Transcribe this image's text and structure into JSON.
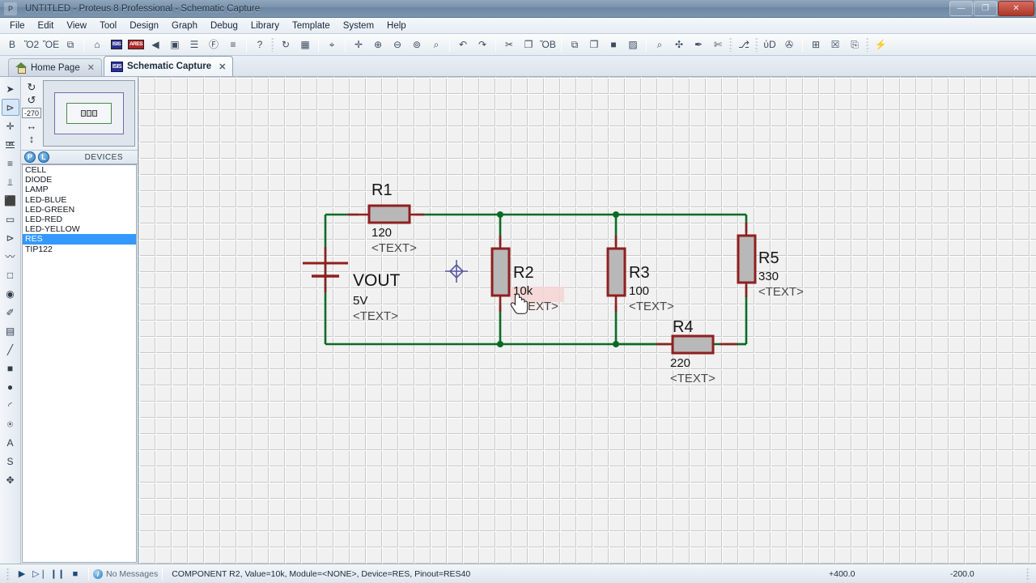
{
  "window": {
    "title": "UNTITLED - Proteus 8 Professional - Schematic Capture",
    "app_icon": "proteus-icon",
    "minimize": "—",
    "maximize": "❐",
    "close": "✕"
  },
  "menu": {
    "items": [
      "File",
      "Edit",
      "View",
      "Tool",
      "Design",
      "Graph",
      "Debug",
      "Library",
      "Template",
      "System",
      "Help"
    ]
  },
  "toolbar": {
    "groups": [
      {
        "buttons": [
          {
            "name": "new-file-icon",
            "glyph": "὜B"
          },
          {
            "name": "open-file-icon",
            "glyph": "Ὄ2"
          },
          {
            "name": "save-icon",
            "glyph": "ὋE"
          },
          {
            "name": "save-all-icon",
            "glyph": "⧉"
          }
        ]
      },
      {
        "buttons": [
          {
            "name": "home-page-icon",
            "glyph": "⌂"
          },
          {
            "name": "isis-schematic-icon",
            "glyph": "ISIS"
          },
          {
            "name": "ares-pcb-icon",
            "glyph": "ARES"
          },
          {
            "name": "back-icon",
            "glyph": "◀"
          },
          {
            "name": "3d-viewer-icon",
            "glyph": "▣"
          },
          {
            "name": "bill-of-materials-icon",
            "glyph": "☰"
          },
          {
            "name": "report-icon",
            "glyph": "Ⓕ"
          },
          {
            "name": "design-explorer-icon",
            "glyph": "≡"
          }
        ]
      },
      {
        "buttons": [
          {
            "name": "help-icon",
            "glyph": "?"
          }
        ]
      },
      {
        "buttons": [
          {
            "name": "refresh-display-icon",
            "glyph": "↻"
          },
          {
            "name": "toggle-grid-icon",
            "glyph": "▦"
          }
        ]
      },
      {
        "buttons": [
          {
            "name": "origin-icon",
            "glyph": "⌖"
          }
        ]
      },
      {
        "buttons": [
          {
            "name": "pan-icon",
            "glyph": "✛"
          },
          {
            "name": "zoom-in-icon",
            "glyph": "⊕"
          },
          {
            "name": "zoom-out-icon",
            "glyph": "⊖"
          },
          {
            "name": "zoom-all-icon",
            "glyph": "⊚"
          },
          {
            "name": "zoom-area-icon",
            "glyph": "⌕"
          }
        ]
      },
      {
        "buttons": [
          {
            "name": "undo-icon",
            "glyph": "↶"
          },
          {
            "name": "redo-icon",
            "glyph": "↷"
          }
        ]
      },
      {
        "buttons": [
          {
            "name": "cut-icon",
            "glyph": "✂"
          },
          {
            "name": "copy-icon",
            "glyph": "❐"
          },
          {
            "name": "paste-icon",
            "glyph": "ὌB"
          }
        ]
      },
      {
        "buttons": [
          {
            "name": "block-copy-icon",
            "glyph": "⧉"
          },
          {
            "name": "block-move-icon",
            "glyph": "❐"
          },
          {
            "name": "block-rotate-icon",
            "glyph": "■"
          },
          {
            "name": "block-delete-icon",
            "glyph": "▨"
          }
        ]
      },
      {
        "buttons": [
          {
            "name": "pick-device-icon",
            "glyph": "⌕"
          },
          {
            "name": "make-device-icon",
            "glyph": "✣"
          },
          {
            "name": "packaging-tool-icon",
            "glyph": "✒"
          },
          {
            "name": "decompose-icon",
            "glyph": "✄"
          }
        ]
      },
      {
        "buttons": [
          {
            "name": "wire-autorouter-icon",
            "glyph": "⎇"
          }
        ]
      },
      {
        "buttons": [
          {
            "name": "search-tag-icon",
            "glyph": "ὐD"
          },
          {
            "name": "property-assignment-icon",
            "glyph": "✇"
          }
        ]
      },
      {
        "buttons": [
          {
            "name": "new-sheet-icon",
            "glyph": "⊞"
          },
          {
            "name": "remove-sheet-icon",
            "glyph": "☒"
          },
          {
            "name": "exit-sheet-icon",
            "glyph": "⎘"
          }
        ]
      },
      {
        "buttons": [
          {
            "name": "simulation-icon",
            "glyph": "⚡"
          }
        ]
      }
    ]
  },
  "tabs": [
    {
      "label": "Home Page",
      "icon": "home-icon",
      "close": "✕",
      "active": false
    },
    {
      "label": "Schematic Capture",
      "icon": "isis-icon",
      "close": "✕",
      "active": true
    }
  ],
  "toolstrip": {
    "items": [
      {
        "name": "selection-mode-tool",
        "glyph": "➤",
        "selected": false
      },
      {
        "name": "component-mode-tool",
        "glyph": "⊳",
        "selected": true
      },
      {
        "name": "junction-dot-tool",
        "glyph": "✛",
        "selected": false
      },
      {
        "name": "wire-label-tool",
        "glyph": "LBL",
        "selected": false
      },
      {
        "name": "text-script-tool",
        "glyph": "≡",
        "selected": false
      },
      {
        "name": "buses-tool",
        "glyph": "⫫",
        "selected": false
      },
      {
        "name": "subcircuit-tool",
        "glyph": "⬛",
        "selected": false
      },
      {
        "name": "terminals-mode-tool",
        "glyph": "▭",
        "selected": false
      },
      {
        "name": "device-pin-tool",
        "glyph": "⊳",
        "selected": false
      },
      {
        "name": "graph-mode-tool",
        "glyph": "〰",
        "selected": false
      },
      {
        "name": "tape-recorder-tool",
        "glyph": "□",
        "selected": false
      },
      {
        "name": "generator-mode-tool",
        "glyph": "◉",
        "selected": false
      },
      {
        "name": "voltage-probe-tool",
        "glyph": "✐",
        "selected": false
      },
      {
        "name": "virtual-instrument-tool",
        "glyph": "▤",
        "selected": false
      },
      {
        "name": "2d-line-tool",
        "glyph": "╱",
        "selected": false
      },
      {
        "name": "2d-box-tool",
        "glyph": "■",
        "selected": false
      },
      {
        "name": "2d-circle-tool",
        "glyph": "●",
        "selected": false
      },
      {
        "name": "2d-arc-tool",
        "glyph": "◜",
        "selected": false
      },
      {
        "name": "2d-path-tool",
        "glyph": "⍟",
        "selected": false
      },
      {
        "name": "2d-text-tool",
        "glyph": "A",
        "selected": false
      },
      {
        "name": "2d-symbol-tool",
        "glyph": "S",
        "selected": false
      },
      {
        "name": "2d-marker-tool",
        "glyph": "✥",
        "selected": false
      }
    ]
  },
  "orientation": {
    "rotate_cw": "↻",
    "rotate_ccw": "↺",
    "angle": "-270",
    "mirror_x": "↔",
    "mirror_y": "↕"
  },
  "devices_panel": {
    "badge_p": "P",
    "badge_l": "L",
    "title": "DEVICES",
    "items": [
      {
        "label": "CELL",
        "selected": false
      },
      {
        "label": "DIODE",
        "selected": false
      },
      {
        "label": "LAMP",
        "selected": false
      },
      {
        "label": "LED-BLUE",
        "selected": false
      },
      {
        "label": "LED-GREEN",
        "selected": false
      },
      {
        "label": "LED-RED",
        "selected": false
      },
      {
        "label": "LED-YELLOW",
        "selected": false
      },
      {
        "label": "RES",
        "selected": true
      },
      {
        "label": "TIP122",
        "selected": false
      }
    ]
  },
  "schematic": {
    "colors": {
      "wire": "#0a6b25",
      "body_border": "#8f1f1f",
      "body_fill": "#b8b8b8",
      "lead": "#8f1f1f",
      "text": "#1a1a1a",
      "placeholder_text": "#4a4a4a",
      "highlight": "#f3c9c9"
    },
    "components": [
      {
        "ref": "R1",
        "value": "120",
        "text": "<TEXT>",
        "orientation": "horizontal",
        "highlighted": false
      },
      {
        "ref": "R2",
        "value": "10k",
        "text": "<TEXT>",
        "orientation": "vertical",
        "highlighted": true
      },
      {
        "ref": "R3",
        "value": "100",
        "text": "<TEXT>",
        "orientation": "vertical",
        "highlighted": false
      },
      {
        "ref": "R4",
        "value": "220",
        "text": "<TEXT>",
        "orientation": "horizontal",
        "highlighted": false
      },
      {
        "ref": "R5",
        "value": "330",
        "text": "<TEXT>",
        "orientation": "vertical",
        "highlighted": false
      },
      {
        "ref": "VOUT",
        "value": "5V",
        "text": "<TEXT>",
        "orientation": "cell",
        "highlighted": false
      }
    ]
  },
  "statusbar": {
    "transport": [
      {
        "name": "play-button",
        "glyph": "▶"
      },
      {
        "name": "step-button",
        "glyph": "▷❘"
      },
      {
        "name": "pause-button",
        "glyph": "❙❙"
      },
      {
        "name": "stop-button",
        "glyph": "■"
      }
    ],
    "messages": "No Messages",
    "component_info": "COMPONENT R2, Value=10k, Module=<NONE>, Device=RES, Pinout=RES40",
    "coord_x": "+400.0",
    "coord_y": "-200.0"
  }
}
